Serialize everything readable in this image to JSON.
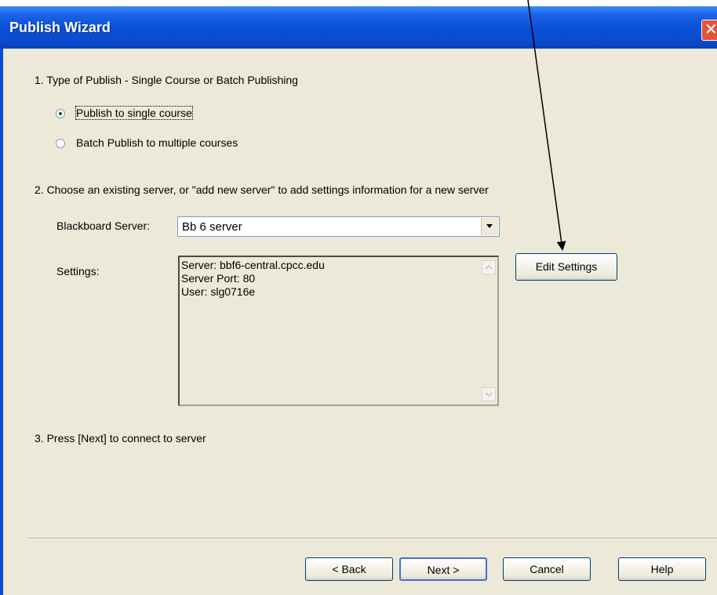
{
  "window": {
    "title": "Publish Wizard"
  },
  "step1": {
    "heading": "1.  Type of Publish - Single Course or Batch Publishing",
    "options": [
      {
        "label": "Publish to single course",
        "selected": true
      },
      {
        "label": "Batch Publish to multiple courses",
        "selected": false
      }
    ]
  },
  "step2": {
    "heading": "2.  Choose an existing server, or \"add new server\" to add settings information for a new server",
    "server_label": "Blackboard Server:",
    "server_value": "Bb 6 server",
    "settings_label": "Settings:",
    "settings_lines": [
      "Server: bbf6-central.cpcc.edu",
      "Server Port: 80",
      "User: slg0716e"
    ],
    "edit_settings_label": "Edit Settings"
  },
  "step3": {
    "heading": "3.  Press [Next] to connect to server"
  },
  "buttons": {
    "back": "< Back",
    "next": "Next >",
    "cancel": "Cancel",
    "help": "Help"
  },
  "colors": {
    "titlebar": "#0a4ccf",
    "dialog_bg": "#ece9d8",
    "close_button": "#e0553a"
  }
}
